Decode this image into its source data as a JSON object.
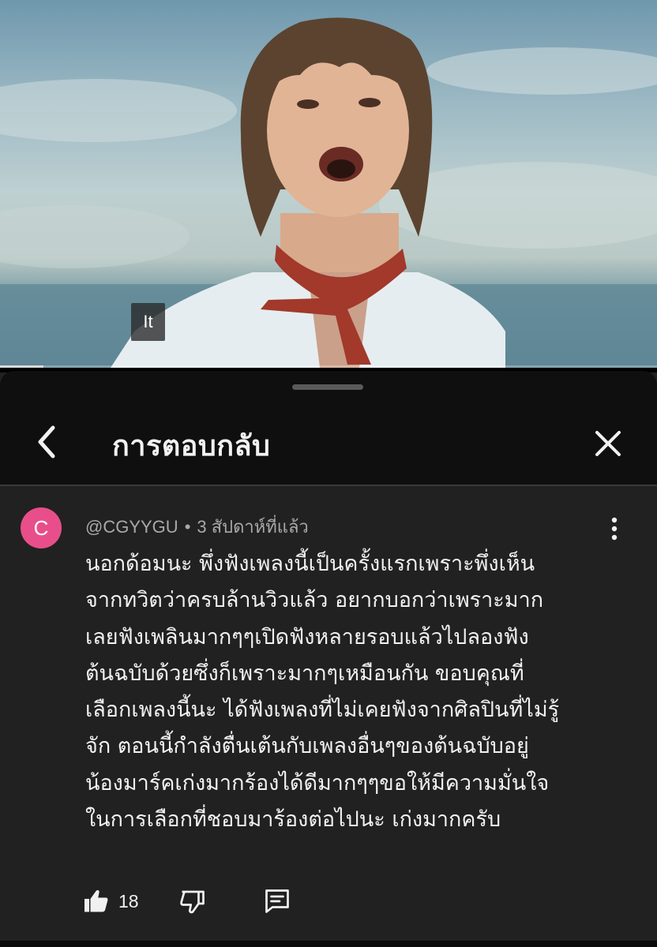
{
  "video": {
    "caption_text": "It",
    "progress_fraction": 0.066
  },
  "sheet": {
    "title": "การตอบกลับ",
    "back_icon": "chevron-left-icon",
    "close_icon": "close-icon"
  },
  "comment": {
    "avatar_letter": "C",
    "avatar_color": "#e84f8a",
    "author": "@CGYYGU",
    "separator": "•",
    "time": "3 สัปดาห์ที่แล้ว",
    "lines": [
      "นอกด้อมนะ พึ่งฟังเพลงนี้เป็นครั้งแรกเพราะพึ่งเห็น",
      "จากทวิตว่าครบล้านวิวแล้ว อยากบอกว่าเพราะมาก",
      "เลยฟังเพลินมากๆๆเปิดฟังหลายรอบแล้วไปลองฟัง",
      "ต้นฉบับด้วยซึ่งก็เพราะมากๆเหมือนกัน ขอบคุณที่",
      "เลือกเพลงนี้นะ ได้ฟังเพลงที่ไม่เคยฟังจากศิลปินที่ไม่รู้",
      "จัก ตอนนี้กำลังตื่นเต้นกับเพลงอื่นๆของต้นฉบับอยู่",
      "น้องมาร์คเก่งมากร้องได้ดีมากๆๆขอให้มีความมั่นใจ",
      "ในการเลือกที่ชอบมาร้องต่อไปนะ เก่งมากครับ"
    ],
    "like_count": "18"
  }
}
